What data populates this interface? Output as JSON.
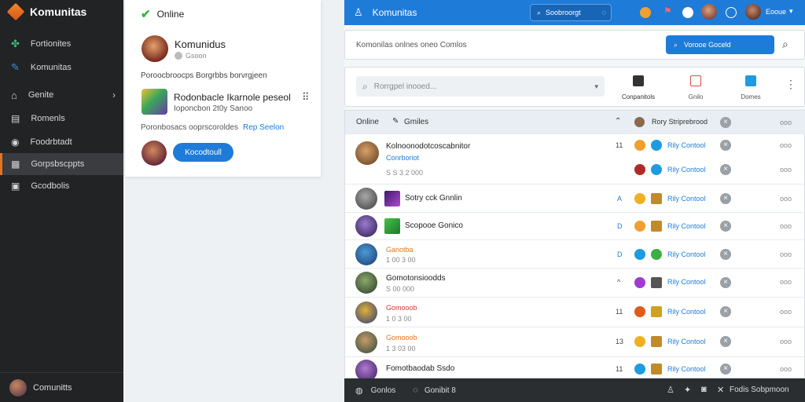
{
  "sidebar": {
    "brand": "Komunitas",
    "items": [
      {
        "label": "Fortionites"
      },
      {
        "label": "Komunitas"
      },
      {
        "label": "Genite"
      },
      {
        "label": "Romenls"
      },
      {
        "label": "Foodrbtadt"
      },
      {
        "label": "Gorpsbscppts"
      },
      {
        "label": "Gcodbolis"
      }
    ],
    "footer": "Comunitts"
  },
  "card": {
    "status": "Online",
    "profile_name": "Komunidus",
    "profile_sub": "Gsoon",
    "desc": "Poroocbroocps Borgrbbs borvrgjeen",
    "item_title": "Rodonbacle Ikarnole peseol",
    "item_sub": "Ioponcbon 2t0y Sanoo",
    "meta_text": "Poronbosacs ooprscoroldes",
    "meta_link": "Rep Seelon",
    "action_button": "Kocodtoull"
  },
  "topbar": {
    "title": "Komunitas",
    "search_label": "Soobroorgt",
    "user_label": "Eooue"
  },
  "filter": {
    "label": "Komonilas onlnes oneo Comlos",
    "button": "Vorooe Goceld"
  },
  "search": {
    "placeholder": "Rorrgpel inooed...",
    "tabs": [
      {
        "label": "Conpanitols"
      },
      {
        "label": "Gnilo"
      },
      {
        "label": "Domes"
      }
    ]
  },
  "list": {
    "header_online": "Online",
    "header_games": "Gmiles",
    "header_right": "Rory Striprebrood",
    "header_time": "ooo",
    "rows": [
      {
        "name": "Kolnoonodotcoscabnitor",
        "sub": "Conrboriot",
        "meta": "S  S 3 2  000",
        "num": "11",
        "action": "Rily Contool",
        "action2": "Rily Contool",
        "time": "ooo",
        "time2": "ooo"
      },
      {
        "name": "Sotry cck Gnnlin",
        "sub": "",
        "meta": "",
        "num": "A",
        "action": "Rily Contool",
        "time": "ooo"
      },
      {
        "name": "Scopooe Gonico",
        "sub": "",
        "meta": "",
        "num": "D",
        "action": "Rily Contool",
        "time": "ooo"
      },
      {
        "name": "Ganotba",
        "sub": "",
        "meta": "1 00 3 00",
        "num": "D",
        "action": "Rily Contool",
        "time": "ooo"
      },
      {
        "name": "Gomotonsioodds",
        "sub": "",
        "meta": "S 00 000",
        "num": "^",
        "action": "Rily Contool",
        "time": "ooo"
      },
      {
        "name": "Gomooob",
        "sub": "",
        "meta": "1 0 3 00",
        "num": "11",
        "action": "Rily Contool",
        "time": "ooo"
      },
      {
        "name": "Gomooob",
        "sub": "",
        "meta": "1 3 03 00",
        "num": "13",
        "action": "Rily Contool",
        "time": "ooo"
      },
      {
        "name": "Fomotbaodab Ssdo",
        "sub": "",
        "meta": "",
        "num": "11",
        "action": "Rily Contool",
        "time": "ooo"
      }
    ]
  },
  "bottom": {
    "left1": "Gonlos",
    "left2": "Gonibit 8",
    "right": "Fodis Sobpmoon"
  },
  "colors": {
    "accent": "#1f7bd8",
    "sidebar": "#212325",
    "active": "#e4741f"
  }
}
